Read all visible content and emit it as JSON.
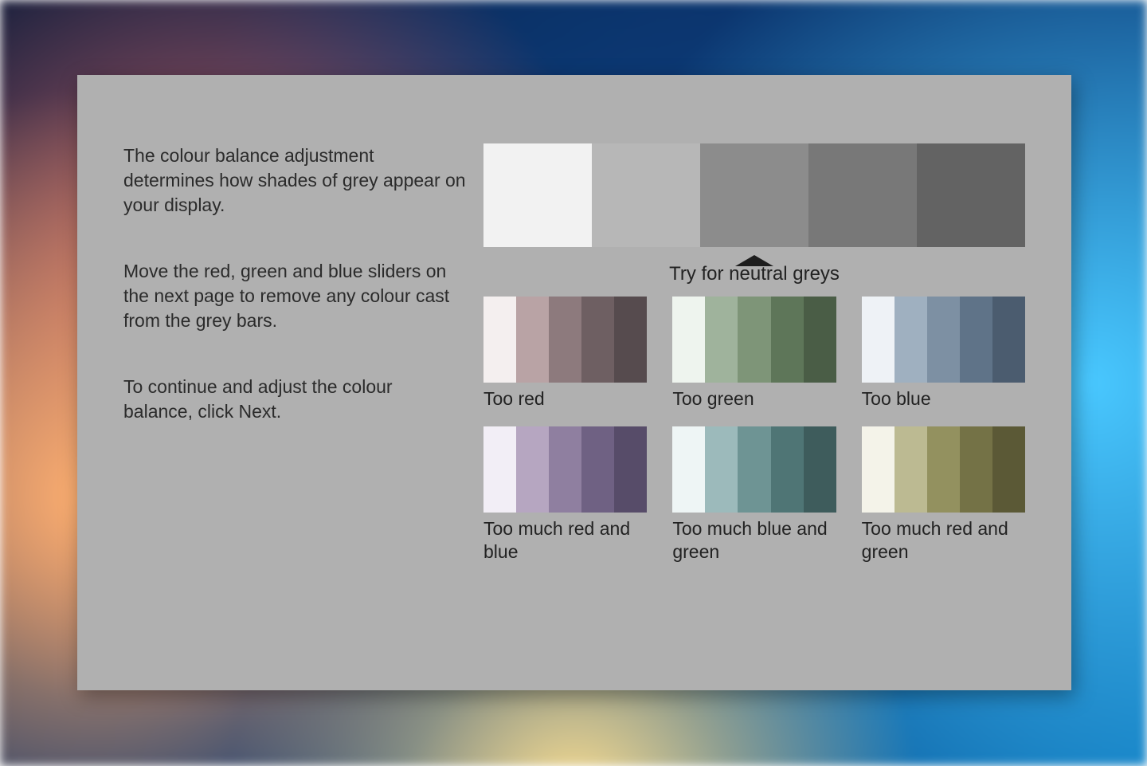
{
  "text": {
    "p1": "The colour balance adjustment determines how shades of grey appear on your display.",
    "p2": "Move the red, green and blue sliders on the next page to remove any colour cast from the grey bars.",
    "p3": "To continue and adjust the colour balance, click Next.",
    "pointer": "Try for neutral greys"
  },
  "neutral_strip": [
    "#f2f2f2",
    "#b7b7b7",
    "#8c8c8c",
    "#787878",
    "#636363"
  ],
  "samples": [
    {
      "label": "Too red",
      "bars": [
        "#f4efef",
        "#b9a3a5",
        "#8d7a7d",
        "#6e5f62",
        "#564b4e"
      ]
    },
    {
      "label": "Too green",
      "bars": [
        "#eef4ee",
        "#9fb39c",
        "#7e9578",
        "#5e7659",
        "#4a5d46"
      ]
    },
    {
      "label": "Too blue",
      "bars": [
        "#eef2f6",
        "#9fb0c0",
        "#7d90a3",
        "#5f7388",
        "#4b5c6f"
      ]
    },
    {
      "label": "Too much red and blue",
      "bars": [
        "#f2eef6",
        "#b6a6c1",
        "#8f7fa0",
        "#6f6183",
        "#574c69"
      ]
    },
    {
      "label": "Too much blue and green",
      "bars": [
        "#eef5f5",
        "#9cbabb",
        "#6e9494",
        "#4f7575",
        "#3e5c5c"
      ]
    },
    {
      "label": "Too much red and green",
      "bars": [
        "#f4f3e9",
        "#bcba92",
        "#93915f",
        "#747246",
        "#5b5936"
      ]
    }
  ]
}
